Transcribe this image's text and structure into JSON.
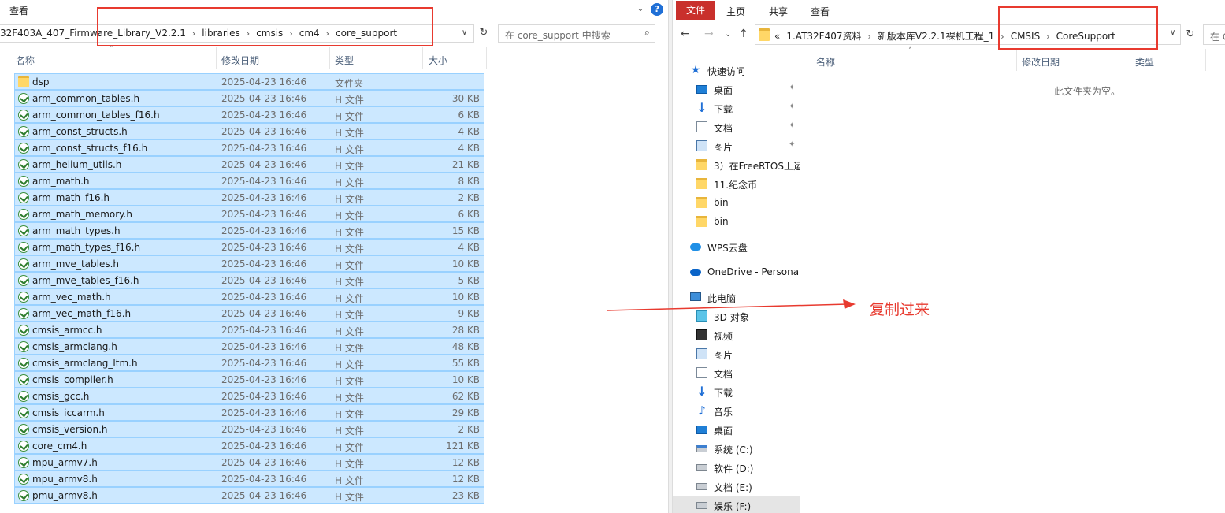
{
  "left": {
    "ribbon_tab": "查看",
    "collapse_glyph": "⌄",
    "help_glyph": "?",
    "breadcrumbs": [
      "32F403A_407_Firmware_Library_V2.2.1",
      "libraries",
      "cmsis",
      "cm4",
      "core_support"
    ],
    "search_placeholder": "在 core_support 中搜索",
    "columns": {
      "name": "名称",
      "date": "修改日期",
      "type": "类型",
      "size": "大小"
    },
    "files": [
      {
        "name": "dsp",
        "date": "2025-04-23 16:46",
        "type": "文件夹",
        "size": "",
        "icon": "folder-icon"
      },
      {
        "name": "arm_common_tables.h",
        "date": "2025-04-23 16:46",
        "type": "H 文件",
        "size": "30 KB",
        "icon": "h-file-icon"
      },
      {
        "name": "arm_common_tables_f16.h",
        "date": "2025-04-23 16:46",
        "type": "H 文件",
        "size": "6 KB",
        "icon": "h-file-icon"
      },
      {
        "name": "arm_const_structs.h",
        "date": "2025-04-23 16:46",
        "type": "H 文件",
        "size": "4 KB",
        "icon": "h-file-icon"
      },
      {
        "name": "arm_const_structs_f16.h",
        "date": "2025-04-23 16:46",
        "type": "H 文件",
        "size": "4 KB",
        "icon": "h-file-icon"
      },
      {
        "name": "arm_helium_utils.h",
        "date": "2025-04-23 16:46",
        "type": "H 文件",
        "size": "21 KB",
        "icon": "h-file-icon"
      },
      {
        "name": "arm_math.h",
        "date": "2025-04-23 16:46",
        "type": "H 文件",
        "size": "8 KB",
        "icon": "h-file-icon"
      },
      {
        "name": "arm_math_f16.h",
        "date": "2025-04-23 16:46",
        "type": "H 文件",
        "size": "2 KB",
        "icon": "h-file-icon"
      },
      {
        "name": "arm_math_memory.h",
        "date": "2025-04-23 16:46",
        "type": "H 文件",
        "size": "6 KB",
        "icon": "h-file-icon"
      },
      {
        "name": "arm_math_types.h",
        "date": "2025-04-23 16:46",
        "type": "H 文件",
        "size": "15 KB",
        "icon": "h-file-icon"
      },
      {
        "name": "arm_math_types_f16.h",
        "date": "2025-04-23 16:46",
        "type": "H 文件",
        "size": "4 KB",
        "icon": "h-file-icon"
      },
      {
        "name": "arm_mve_tables.h",
        "date": "2025-04-23 16:46",
        "type": "H 文件",
        "size": "10 KB",
        "icon": "h-file-icon"
      },
      {
        "name": "arm_mve_tables_f16.h",
        "date": "2025-04-23 16:46",
        "type": "H 文件",
        "size": "5 KB",
        "icon": "h-file-icon"
      },
      {
        "name": "arm_vec_math.h",
        "date": "2025-04-23 16:46",
        "type": "H 文件",
        "size": "10 KB",
        "icon": "h-file-icon"
      },
      {
        "name": "arm_vec_math_f16.h",
        "date": "2025-04-23 16:46",
        "type": "H 文件",
        "size": "9 KB",
        "icon": "h-file-icon"
      },
      {
        "name": "cmsis_armcc.h",
        "date": "2025-04-23 16:46",
        "type": "H 文件",
        "size": "28 KB",
        "icon": "h-file-icon"
      },
      {
        "name": "cmsis_armclang.h",
        "date": "2025-04-23 16:46",
        "type": "H 文件",
        "size": "48 KB",
        "icon": "h-file-icon"
      },
      {
        "name": "cmsis_armclang_ltm.h",
        "date": "2025-04-23 16:46",
        "type": "H 文件",
        "size": "55 KB",
        "icon": "h-file-icon"
      },
      {
        "name": "cmsis_compiler.h",
        "date": "2025-04-23 16:46",
        "type": "H 文件",
        "size": "10 KB",
        "icon": "h-file-icon"
      },
      {
        "name": "cmsis_gcc.h",
        "date": "2025-04-23 16:46",
        "type": "H 文件",
        "size": "62 KB",
        "icon": "h-file-icon"
      },
      {
        "name": "cmsis_iccarm.h",
        "date": "2025-04-23 16:46",
        "type": "H 文件",
        "size": "29 KB",
        "icon": "h-file-icon"
      },
      {
        "name": "cmsis_version.h",
        "date": "2025-04-23 16:46",
        "type": "H 文件",
        "size": "2 KB",
        "icon": "h-file-icon"
      },
      {
        "name": "core_cm4.h",
        "date": "2025-04-23 16:46",
        "type": "H 文件",
        "size": "121 KB",
        "icon": "h-file-icon"
      },
      {
        "name": "mpu_armv7.h",
        "date": "2025-04-23 16:46",
        "type": "H 文件",
        "size": "12 KB",
        "icon": "h-file-icon"
      },
      {
        "name": "mpu_armv8.h",
        "date": "2025-04-23 16:46",
        "type": "H 文件",
        "size": "12 KB",
        "icon": "h-file-icon"
      },
      {
        "name": "pmu_armv8.h",
        "date": "2025-04-23 16:46",
        "type": "H 文件",
        "size": "23 KB",
        "icon": "h-file-icon"
      }
    ]
  },
  "right": {
    "ribbon": {
      "file": "文件",
      "home": "主页",
      "share": "共享",
      "view": "查看"
    },
    "nav_glyphs": {
      "back": "←",
      "forward": "→",
      "recent": "⌄",
      "up": "↑"
    },
    "address_prefix": "«",
    "breadcrumbs": [
      "1.AT32F407资料",
      "新版本库V2.2.1裸机工程_1",
      "CMSIS",
      "CoreSupport"
    ],
    "search_placeholder": "在 CoreSupport 中搜索",
    "columns": {
      "name": "名称",
      "date": "修改日期",
      "type": "类型"
    },
    "empty_text": "此文件夹为空。",
    "nav_pane": [
      {
        "label": "快速访问",
        "icon": "star-icon",
        "pinned": false
      },
      {
        "label": "桌面",
        "icon": "desktop-icon",
        "pinned": true
      },
      {
        "label": "下载",
        "icon": "download-icon",
        "pinned": true
      },
      {
        "label": "文档",
        "icon": "document-icon",
        "pinned": true
      },
      {
        "label": "图片",
        "icon": "pictures-icon",
        "pinned": true
      },
      {
        "label": "3）在FreeRTOS上运",
        "icon": "folder-icon",
        "pinned": false
      },
      {
        "label": "11.纪念币",
        "icon": "folder-icon",
        "pinned": false
      },
      {
        "label": "bin",
        "icon": "folder-icon",
        "pinned": false
      },
      {
        "label": "bin",
        "icon": "folder-icon",
        "pinned": false
      },
      {
        "label": "WPS云盘",
        "icon": "wps-cloud-icon",
        "pinned": false
      },
      {
        "label": "OneDrive - Personal",
        "icon": "onedrive-icon",
        "pinned": false
      },
      {
        "label": "此电脑",
        "icon": "this-pc-icon",
        "pinned": false
      },
      {
        "label": "3D 对象",
        "icon": "3d-objects-icon",
        "pinned": false
      },
      {
        "label": "视频",
        "icon": "video-icon",
        "pinned": false
      },
      {
        "label": "图片",
        "icon": "pictures-icon",
        "pinned": false
      },
      {
        "label": "文档",
        "icon": "document-icon",
        "pinned": false
      },
      {
        "label": "下载",
        "icon": "download-icon",
        "pinned": false
      },
      {
        "label": "音乐",
        "icon": "music-icon",
        "pinned": false
      },
      {
        "label": "桌面",
        "icon": "desktop-icon",
        "pinned": false
      },
      {
        "label": "系统 (C:)",
        "icon": "system-drive-icon",
        "pinned": false
      },
      {
        "label": "软件 (D:)",
        "icon": "drive-icon",
        "pinned": false
      },
      {
        "label": "文档 (E:)",
        "icon": "drive-icon",
        "pinned": false
      },
      {
        "label": "娱乐 (F:)",
        "icon": "drive-icon",
        "pinned": false,
        "selected": true
      }
    ]
  },
  "annotation": {
    "label": "复制过来",
    "color": "#e83a2f"
  },
  "colors": {
    "selection_bg": "#cce8ff",
    "selection_border": "#99d1ff",
    "file_tab": "#c9302c"
  }
}
